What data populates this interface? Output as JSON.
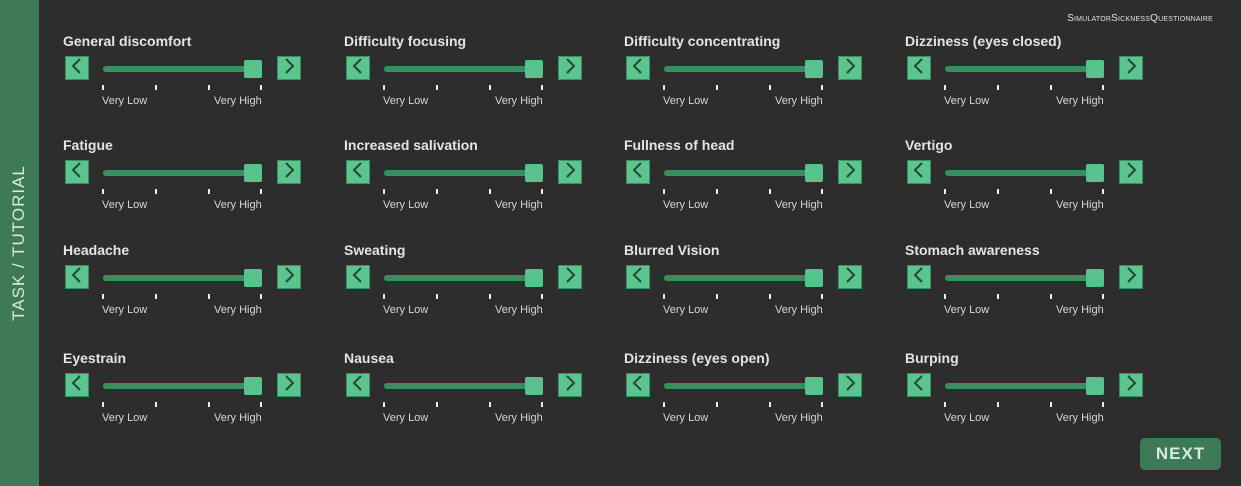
{
  "sidebar": {
    "label": "TASK / TUTORIAL"
  },
  "header": {
    "title": "SimulatorSicknessQuestionnaire"
  },
  "scale": {
    "low_label": "Very Low",
    "high_label": "Very High"
  },
  "questions": [
    {
      "label": "General discomfort",
      "value": 1.0
    },
    {
      "label": "Difficulty focusing",
      "value": 1.0
    },
    {
      "label": "Difficulty concentrating",
      "value": 1.0
    },
    {
      "label": "Dizziness (eyes closed)",
      "value": 1.0
    },
    {
      "label": "Fatigue",
      "value": 1.0
    },
    {
      "label": "Increased salivation",
      "value": 1.0
    },
    {
      "label": "Fullness of head",
      "value": 1.0
    },
    {
      "label": "Vertigo",
      "value": 1.0
    },
    {
      "label": "Headache",
      "value": 1.0
    },
    {
      "label": "Sweating",
      "value": 1.0
    },
    {
      "label": "Blurred Vision",
      "value": 1.0
    },
    {
      "label": "Stomach awareness",
      "value": 1.0
    },
    {
      "label": "Eyestrain",
      "value": 1.0
    },
    {
      "label": "Nausea",
      "value": 1.0
    },
    {
      "label": "Dizziness (eyes open)",
      "value": 1.0
    },
    {
      "label": "Burping",
      "value": 1.0
    }
  ],
  "icons": {
    "left": "chevron-left-icon",
    "right": "chevron-right-icon"
  },
  "colors": {
    "accent": "#5cc48e",
    "sidebar": "#3d7a55",
    "background": "#2d2d2d"
  },
  "actions": {
    "next_label": "NEXT"
  }
}
